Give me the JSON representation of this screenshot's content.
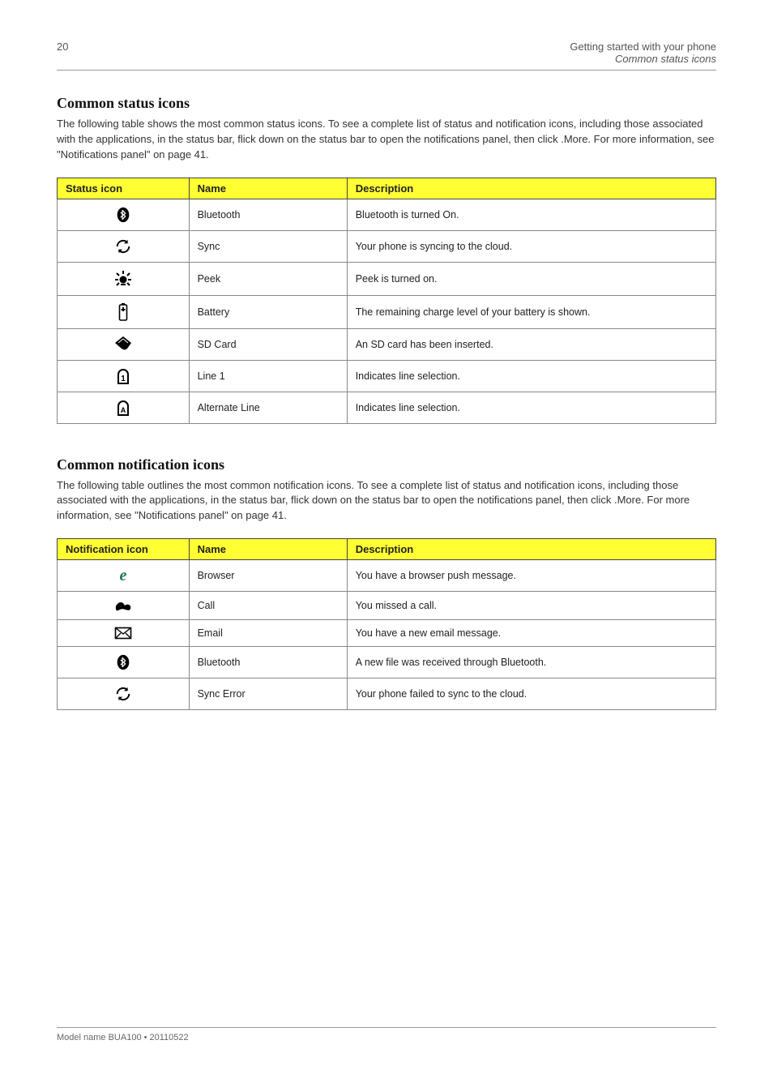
{
  "header": {
    "page_number": "20",
    "crumb_line1": "Getting started with your phone",
    "crumb_line2": "Common status icons"
  },
  "section1": {
    "title": "Common status icons",
    "description": "The following table shows the most common status icons. To see a complete list of status and notification icons, including those associated with the applications, in the status bar, flick down on the status bar to open the notifications panel, then click .More. For more information, see \"Notifications panel\" on page 41.",
    "table": {
      "headers": [
        "Status icon",
        "Name",
        "Description"
      ],
      "rows": [
        {
          "icon": "bluetooth",
          "name": "Bluetooth",
          "desc": "Bluetooth is turned On."
        },
        {
          "icon": "sync",
          "name": "Sync",
          "desc": "Your phone is syncing to the cloud."
        },
        {
          "icon": "brightness",
          "name": "Peek",
          "desc": "Peek is turned on."
        },
        {
          "icon": "battery",
          "name": "Battery",
          "desc": "The remaining charge level of your battery is shown."
        },
        {
          "icon": "sdcard",
          "name": "SD Card",
          "desc": "An SD card has been inserted."
        },
        {
          "icon": "line1",
          "name": "Line 1",
          "desc": "Indicates line selection."
        },
        {
          "icon": "alternateline",
          "name": "Alternate Line",
          "desc": "Indicates line selection."
        }
      ]
    }
  },
  "section2": {
    "title": "Common notification icons",
    "description": "The following table outlines the most common notification icons. To see a complete list of status and notification icons, including those associated with the applications, in the status bar, flick down on the status bar to open the notifications panel, then click .More. For more information, see \"Notifications panel\" on page 41.",
    "table": {
      "headers": [
        "Notification icon",
        "Name",
        "Description"
      ],
      "rows": [
        {
          "icon": "browser",
          "name": "Browser",
          "desc": "You have a browser push message."
        },
        {
          "icon": "phone",
          "name": "Call",
          "desc": "You missed a call."
        },
        {
          "icon": "email",
          "name": "Email",
          "desc": "You have a new email message."
        },
        {
          "icon": "bluetooth",
          "name": "Bluetooth",
          "desc": "A new file was received through Bluetooth."
        },
        {
          "icon": "sync",
          "name": "Sync Error",
          "desc": "Your phone failed to sync to the cloud."
        }
      ]
    }
  },
  "footer": {
    "text": "Model name BUA100 • 20110522"
  }
}
